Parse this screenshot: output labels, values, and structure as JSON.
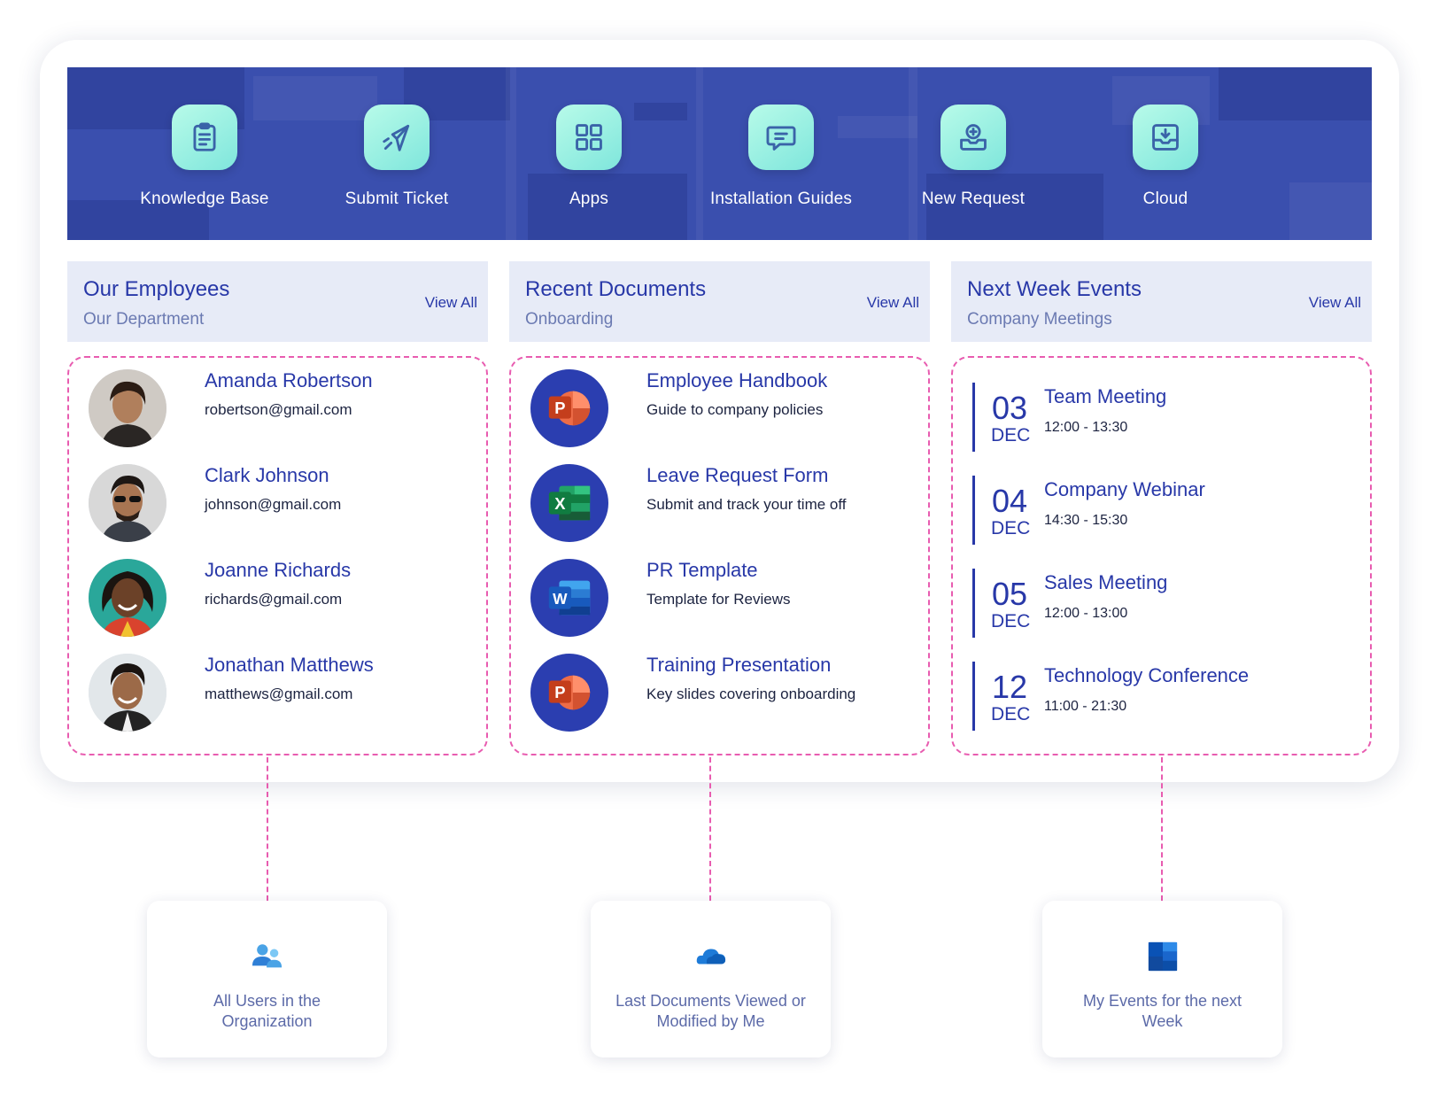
{
  "quick_links": [
    {
      "label": "Knowledge Base",
      "icon": "clipboard-icon"
    },
    {
      "label": "Submit Ticket",
      "icon": "paper-plane-icon"
    },
    {
      "label": "Apps",
      "icon": "grid-icon"
    },
    {
      "label": "Installation Guides",
      "icon": "chat-bubble-icon"
    },
    {
      "label": "New Request",
      "icon": "inbox-plus-icon"
    },
    {
      "label": "Cloud",
      "icon": "download-tray-icon"
    }
  ],
  "employees_panel": {
    "title": "Our Employees",
    "subtitle": "Our Department",
    "view_all": "View All",
    "items": [
      {
        "name": "Amanda Robertson",
        "email": "robertson@gmail.com"
      },
      {
        "name": "Clark Johnson",
        "email": "johnson@gmail.com"
      },
      {
        "name": "Joanne Richards",
        "email": "richards@gmail.com"
      },
      {
        "name": "Jonathan Matthews",
        "email": "matthews@gmail.com"
      }
    ]
  },
  "documents_panel": {
    "title": "Recent Documents",
    "subtitle": "Onboarding",
    "view_all": "View All",
    "items": [
      {
        "name": "Employee Handbook",
        "description": "Guide to company policies",
        "app": "P",
        "icon": "powerpoint-icon"
      },
      {
        "name": "Leave Request Form",
        "description": "Submit and track your time off",
        "app": "X",
        "icon": "excel-icon"
      },
      {
        "name": "PR Template",
        "description": "Template for Reviews",
        "app": "W",
        "icon": "word-icon"
      },
      {
        "name": "Training Presentation",
        "description": "Key slides covering onboarding",
        "app": "P",
        "icon": "powerpoint-icon"
      }
    ]
  },
  "events_panel": {
    "title": "Next Week Events",
    "subtitle": "Company Meetings",
    "view_all": "View All",
    "items": [
      {
        "day": "03",
        "month": "DEC",
        "title": "Team Meeting",
        "time": "12:00 - 13:30"
      },
      {
        "day": "04",
        "month": "DEC",
        "title": "Company Webinar",
        "time": "14:30 - 15:30"
      },
      {
        "day": "05",
        "month": "DEC",
        "title": "Sales Meeting",
        "time": "12:00 - 13:00"
      },
      {
        "day": "12",
        "month": "DEC",
        "title": "Technology Conference",
        "time": "11:00 - 21:30"
      }
    ]
  },
  "sources": [
    {
      "label": "All Users in the Organization",
      "icon": "users-icon"
    },
    {
      "label": "Last Documents Viewed or Modified by Me",
      "icon": "onedrive-cloud-icon"
    },
    {
      "label": "My Events for the next Week",
      "icon": "outlook-calendar-icon"
    }
  ],
  "colors": {
    "banner": "#3a4fae",
    "accent": "#2838a8",
    "dashed_border": "#e85cb0",
    "header_bg": "#e7ebf7"
  }
}
